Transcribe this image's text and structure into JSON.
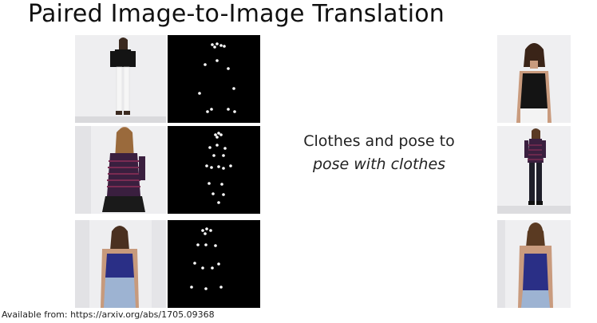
{
  "title": "Paired Image-to-Image Translation",
  "caption": {
    "line1": "Clothes and pose to",
    "line2": "pose with clothes"
  },
  "source": "Available from: https://arxiv.org/abs/1705.09368",
  "colors": {
    "pose_background": "#000000",
    "keypoint": "#ffffff",
    "top_black": "#141414",
    "top_striped": "#3a1f3f",
    "top_navy": "#2a2f86",
    "jeans": "#9db3d2"
  }
}
